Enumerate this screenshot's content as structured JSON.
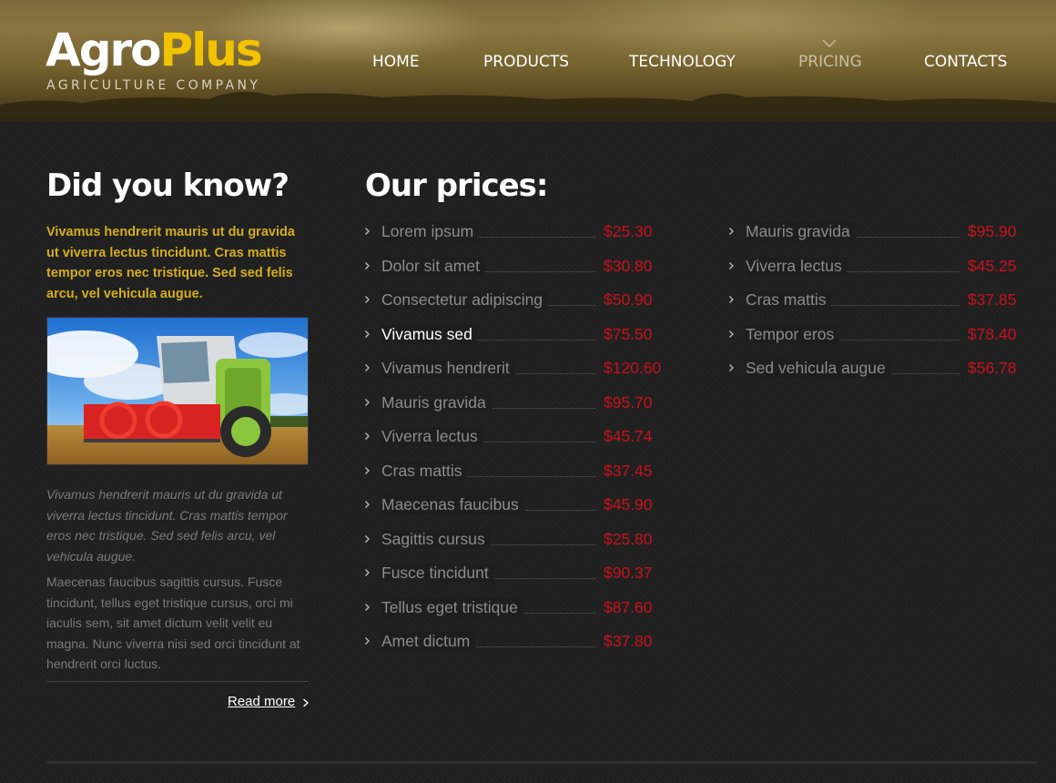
{
  "logo": {
    "main_a": "Agro",
    "main_b": "Plus",
    "tagline": "AGRICULTURE COMPANY"
  },
  "nav": {
    "items": [
      {
        "label": "HOME"
      },
      {
        "label": "PRODUCTS"
      },
      {
        "label": "TECHNOLOGY"
      },
      {
        "label": "PRICING",
        "active": true
      },
      {
        "label": "CONTACTS"
      }
    ]
  },
  "sidebar": {
    "title": "Did you know?",
    "intro": "Vivamus hendrerit mauris ut du gravida ut viverra lectus tincidunt. Cras mattis tempor eros nec tristique. Sed sed felis arcu, vel vehicula augue.",
    "caption": "Vivamus hendrerit mauris ut du gravida ut viverra lectus tincidunt. Cras mattis tempor eros nec tristique. Sed sed felis arcu, vel vehicula augue.",
    "body": "Maecenas faucibus sagittis cursus. Fusce tincidunt, tellus eget tristique cursus, orci mi iaculis sem, sit amet dictum velit velit eu magna. Nunc viverra nisi sed orci tincidunt at hendrerit orci luctus.",
    "read_more": "Read more"
  },
  "prices": {
    "title": "Our prices:",
    "column1": [
      {
        "name": "Lorem ipsum",
        "price": "$25.30"
      },
      {
        "name": "Dolor sit amet",
        "price": "$30.80"
      },
      {
        "name": "Consectetur adipiscing",
        "price": "$50.90"
      },
      {
        "name": "Vivamus sed",
        "price": "$75.50",
        "highlight": true
      },
      {
        "name": "Vivamus hendrerit",
        "price": "$120.60"
      },
      {
        "name": "Mauris gravida",
        "price": "$95.70"
      },
      {
        "name": "Viverra lectus",
        "price": "$45.74"
      },
      {
        "name": "Cras mattis",
        "price": "$37.45"
      },
      {
        "name": "Maecenas faucibus",
        "price": "$45.90"
      },
      {
        "name": "Sagittis cursus",
        "price": "$25.80"
      },
      {
        "name": "Fusce tincidunt",
        "price": "$90.37"
      },
      {
        "name": "Tellus eget tristique",
        "price": "$87.60"
      },
      {
        "name": "Amet dictum",
        "price": "$37.80"
      }
    ],
    "column2": [
      {
        "name": "Mauris gravida",
        "price": "$95.90"
      },
      {
        "name": "Viverra lectus",
        "price": "$45.25"
      },
      {
        "name": "Cras mattis",
        "price": "$37.85"
      },
      {
        "name": "Tempor eros",
        "price": "$78.40"
      },
      {
        "name": "Sed vehicula augue",
        "price": "$56.78"
      }
    ]
  },
  "colors": {
    "brand_yellow": "#f2c300",
    "price_red": "#c8121a",
    "intro_gold": "#d4ae1c"
  }
}
